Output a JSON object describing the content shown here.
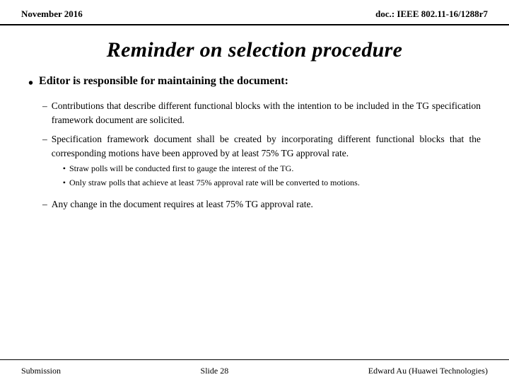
{
  "header": {
    "date": "November 2016",
    "doc_id": "doc.: IEEE 802.11-16/1288r7"
  },
  "title": "Reminder on selection procedure",
  "content": {
    "main_bullet": "Editor is responsible for maintaining the document:",
    "sub_items": [
      {
        "text": "Contributions that describe different functional blocks with the intention to be included in the TG specification framework document are solicited."
      },
      {
        "text": "Specification framework document shall be created by incorporating different functional blocks that the corresponding motions have been approved by at least 75% TG approval rate.",
        "bullet_points": [
          "Straw polls will be conducted first to gauge the interest of the TG.",
          "Only straw polls that achieve at least 75% approval rate will be converted to motions."
        ]
      },
      {
        "text": "Any change in the document requires at least 75% TG approval rate."
      }
    ]
  },
  "footer": {
    "left": "Submission",
    "center": "Slide 28",
    "right": "Edward Au (Huawei Technologies)"
  }
}
